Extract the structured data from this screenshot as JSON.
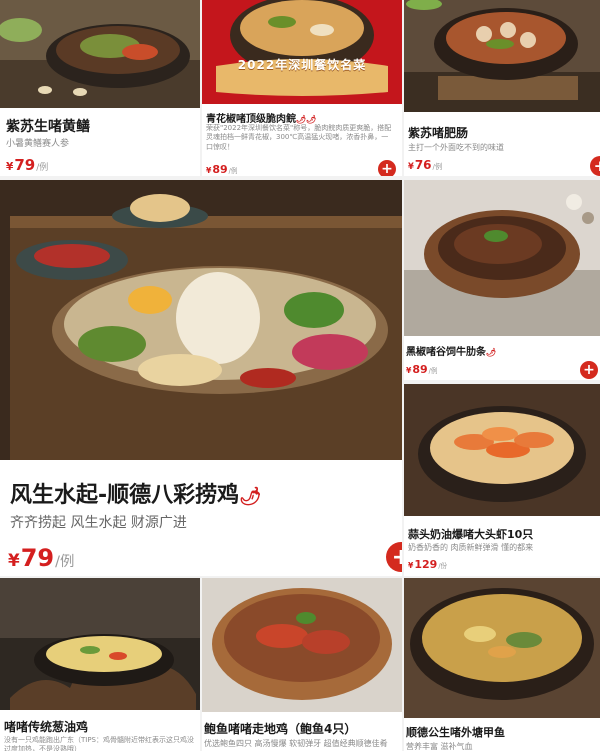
{
  "dishes": [
    {
      "id": "zisu-huangshan",
      "name": "紫苏生啫黄鳝",
      "desc": "小暑黄鳝赛人参",
      "currency": "¥",
      "price": "79",
      "unit": "/例",
      "spicy": false
    },
    {
      "id": "qinghuajiao-cuiroushou",
      "name": "青花椒啫顶级脆肉鲩",
      "desc": "荣获\"2022年深圳餐饮名菜\"称号，脆肉鲩肉质更爽脆，搭配灵魂拍档一鲜青花椒，300℃高温猛火现啫，浓香扑鼻，一口惊叹！",
      "badge": "2022年深圳餐饮名菜",
      "currency": "¥",
      "price": "89",
      "unit": "/例",
      "spicy": true,
      "chili_text": "🌶🌶"
    },
    {
      "id": "zisu-feichang",
      "name": "紫苏啫肥肠",
      "desc": "主打一个外面吃不到的味道",
      "currency": "¥",
      "price": "76",
      "unit": "/例",
      "spicy": false
    },
    {
      "id": "fengsheng-shuiqi",
      "name": "风生水起-顺德八彩捞鸡",
      "desc": "齐齐捞起 风生水起 财源广进",
      "currency": "¥",
      "price": "79",
      "unit": "/例",
      "spicy": true,
      "chili_text": "🌶"
    },
    {
      "id": "heijiao-niurou",
      "name": "黑椒啫谷饲牛肋条",
      "desc": "",
      "currency": "¥",
      "price": "89",
      "unit": "/例",
      "spicy": true,
      "chili_text": "🌶"
    },
    {
      "id": "suantou-daxia",
      "name": "蒜头奶油爆啫大头虾10只",
      "desc": "奶香奶香的 肉质新鲜弹滑 懂的都来",
      "currency": "¥",
      "price": "129",
      "unit": "/份",
      "spicy": false
    },
    {
      "id": "congyou-ji",
      "name": "啫啫传统葱油鸡",
      "desc": "没有一只鸡能跑出广东（TIPS：鸡骨髓附近带红表示这只鸡没过度加热，不是没熟哦）",
      "spicy": false
    },
    {
      "id": "pao-yu-ji",
      "name": "鲍鱼啫啫走地鸡（鲍鱼4只）",
      "desc": "优选鲍鱼四只 高汤慢爆 软韧弹牙 超值经典顺德佳肴",
      "spicy": false
    },
    {
      "id": "tangjiayu",
      "name": "顺德公生啫外塘甲鱼",
      "desc": "营养丰富 滋补气血",
      "spicy": false
    }
  ],
  "add_label": "+",
  "colors": {
    "accent": "#d42a1e",
    "price": "#d41f1f",
    "badge_gold": "#e8b86a",
    "badge_red": "#c4161c"
  }
}
